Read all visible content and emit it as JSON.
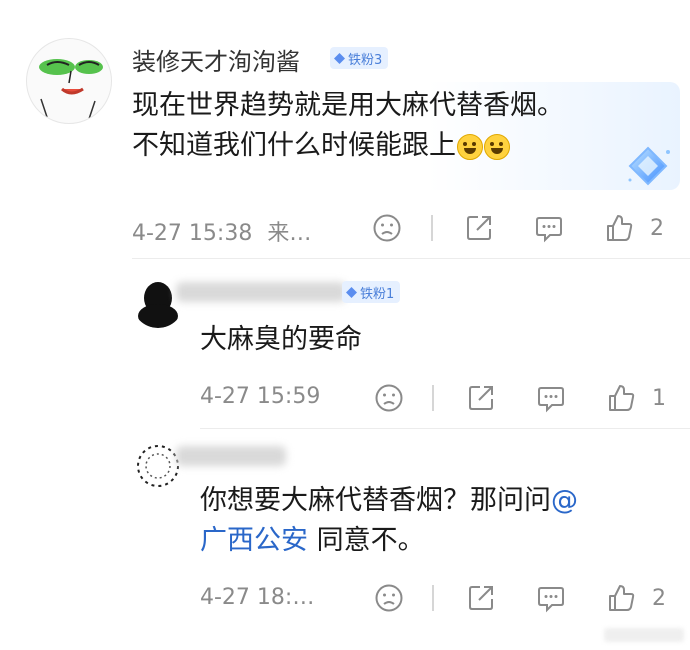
{
  "comments": [
    {
      "username": "装修天才洵洵酱",
      "badge": "铁粉3",
      "text_line1": "现在世界趋势就是用大麻代替香烟。",
      "text_line2": "不知道我们什么时候能跟上",
      "emojis": [
        "laughing-crying-emoji",
        "laughing-crying-emoji"
      ],
      "timestamp": "4-27 15:38",
      "source": "来…",
      "like_count": "2"
    },
    {
      "username": "",
      "badge": "铁粉1",
      "text": "大麻臭的要命",
      "timestamp": "4-27 15:59",
      "like_count": "1"
    },
    {
      "username": "",
      "text_line1_pre": "你想要大麻代替香烟？那问问",
      "mention_at": "@",
      "mention_name": "广西公安",
      "text_line2_post": " 同意不。",
      "timestamp": "4-27 18:…",
      "like_count": "2"
    }
  ],
  "icons": [
    "frown-icon",
    "share-icon",
    "comment-icon",
    "thumbs-up-icon",
    "diamond-badge-icon"
  ],
  "colors": {
    "mention": "#2a67c9",
    "badge_bg": "#e6f0ff",
    "badge_text": "#4a7fd9",
    "meta": "#8a8a8a"
  }
}
